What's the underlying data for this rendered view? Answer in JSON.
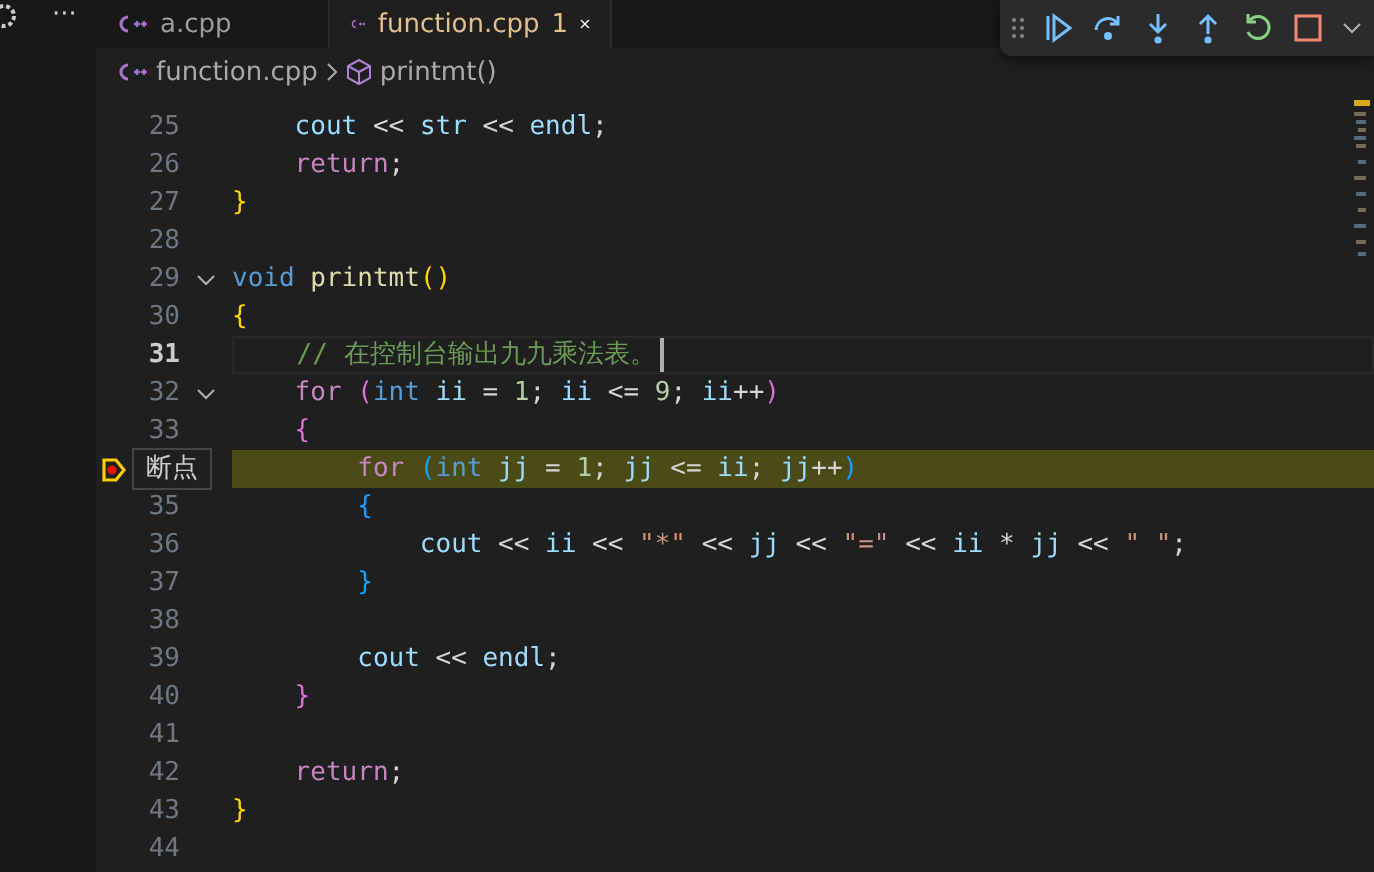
{
  "activity": {
    "more": "···"
  },
  "tabs": [
    {
      "label": "a.cpp",
      "selected": false
    },
    {
      "label": "function.cpp",
      "badge": "1",
      "selected": true
    }
  ],
  "breadcrumb": {
    "file": "function.cpp",
    "symbol": "printmt()"
  },
  "lines": [
    {
      "number": "25",
      "current": false,
      "breakpoint": false,
      "fold": false,
      "tokens": [
        {
          "text": "    cout",
          "kind": "var"
        },
        {
          "text": " << "
        },
        {
          "text": "str",
          "kind": "var"
        },
        {
          "text": " << "
        },
        {
          "text": "endl",
          "kind": "var"
        },
        {
          "text": ";"
        }
      ]
    },
    {
      "number": "26",
      "current": false,
      "breakpoint": false,
      "fold": false,
      "tokens": [
        {
          "text": "    return",
          "kind": "control"
        },
        {
          "text": ";"
        }
      ]
    },
    {
      "number": "27",
      "current": false,
      "breakpoint": false,
      "fold": false,
      "tokens": [
        {
          "text": "}",
          "kind": "brace1"
        }
      ]
    },
    {
      "number": "28",
      "current": false,
      "breakpoint": false,
      "fold": false
    },
    {
      "number": "29",
      "current": false,
      "breakpoint": false,
      "fold": true,
      "tokens": [
        {
          "text": "void",
          "kind": "type"
        },
        {
          "text": " printmt",
          "kind": "func"
        },
        {
          "text": "()",
          "kind": "brace1"
        }
      ]
    },
    {
      "number": "30",
      "current": false,
      "breakpoint": false,
      "fold": false,
      "tokens": [
        {
          "text": "{",
          "kind": "brace1"
        }
      ]
    },
    {
      "number": "31",
      "current": true,
      "breakpoint": false,
      "fold": false,
      "tokens": [
        {
          "text": "    // 在控制台输出九九乘法表。",
          "kind": "comment"
        }
      ]
    },
    {
      "number": "32",
      "current": false,
      "breakpoint": false,
      "fold": true,
      "tokens": [
        {
          "text": "    for",
          "kind": "control"
        },
        {
          "text": " (",
          "kind": "brace2"
        },
        {
          "text": "int",
          "kind": "type"
        },
        {
          "text": " ii",
          "kind": "var"
        },
        {
          "text": " = "
        },
        {
          "text": "1",
          "kind": "num"
        },
        {
          "text": "; "
        },
        {
          "text": "ii",
          "kind": "var"
        },
        {
          "text": " <= "
        },
        {
          "text": "9",
          "kind": "num"
        },
        {
          "text": "; "
        },
        {
          "text": "ii",
          "kind": "var"
        },
        {
          "text": "++"
        },
        {
          "text": ")",
          "kind": "brace2"
        }
      ]
    },
    {
      "number": "33",
      "current": false,
      "breakpoint": false,
      "fold": false,
      "tokens": [
        {
          "text": "    {",
          "kind": "brace2"
        }
      ]
    },
    {
      "current": false,
      "breakpoint": true,
      "fold": false,
      "tokens": [
        {
          "text": "        for",
          "kind": "control"
        },
        {
          "text": " (",
          "kind": "brace3"
        },
        {
          "text": "int",
          "kind": "type"
        },
        {
          "text": " jj",
          "kind": "var"
        },
        {
          "text": " = "
        },
        {
          "text": "1",
          "kind": "num"
        },
        {
          "text": "; "
        },
        {
          "text": "jj",
          "kind": "var"
        },
        {
          "text": " <= "
        },
        {
          "text": "ii",
          "kind": "var"
        },
        {
          "text": "; "
        },
        {
          "text": "jj",
          "kind": "var"
        },
        {
          "text": "++"
        },
        {
          "text": ")",
          "kind": "brace3"
        }
      ]
    },
    {
      "number": "35",
      "current": false,
      "breakpoint": false,
      "fold": false,
      "tokens": [
        {
          "text": "        {",
          "kind": "brace3"
        }
      ]
    },
    {
      "number": "36",
      "current": false,
      "breakpoint": false,
      "fold": false,
      "tokens": [
        {
          "text": "            cout",
          "kind": "var"
        },
        {
          "text": " << "
        },
        {
          "text": "ii",
          "kind": "var"
        },
        {
          "text": " << "
        },
        {
          "text": "\"*\"",
          "kind": "str"
        },
        {
          "text": " << "
        },
        {
          "text": "jj",
          "kind": "var"
        },
        {
          "text": " << "
        },
        {
          "text": "\"=\"",
          "kind": "str"
        },
        {
          "text": " << "
        },
        {
          "text": "ii",
          "kind": "var"
        },
        {
          "text": " * "
        },
        {
          "text": "jj",
          "kind": "var"
        },
        {
          "text": " << "
        },
        {
          "text": "\" \"",
          "kind": "str"
        },
        {
          "text": ";"
        }
      ]
    },
    {
      "number": "37",
      "current": false,
      "breakpoint": false,
      "fold": false,
      "tokens": [
        {
          "text": "        }",
          "kind": "brace3"
        }
      ]
    },
    {
      "number": "38",
      "current": false,
      "breakpoint": false,
      "fold": false
    },
    {
      "number": "39",
      "current": false,
      "breakpoint": false,
      "fold": false,
      "tokens": [
        {
          "text": "        cout",
          "kind": "var"
        },
        {
          "text": " << "
        },
        {
          "text": "endl",
          "kind": "var"
        },
        {
          "text": ";"
        }
      ]
    },
    {
      "number": "40",
      "current": false,
      "breakpoint": false,
      "fold": false,
      "tokens": [
        {
          "text": "    }",
          "kind": "brace2"
        }
      ]
    },
    {
      "number": "41",
      "current": false,
      "breakpoint": false,
      "fold": false
    },
    {
      "number": "42",
      "current": false,
      "breakpoint": false,
      "fold": false,
      "tokens": [
        {
          "text": "    return",
          "kind": "control"
        },
        {
          "text": ";"
        }
      ]
    },
    {
      "number": "43",
      "current": false,
      "breakpoint": false,
      "fold": false,
      "tokens": [
        {
          "text": "}",
          "kind": "brace1"
        }
      ]
    },
    {
      "number": "44",
      "current": false,
      "breakpoint": false,
      "fold": false
    }
  ],
  "breakpoint_tooltip": "断点"
}
